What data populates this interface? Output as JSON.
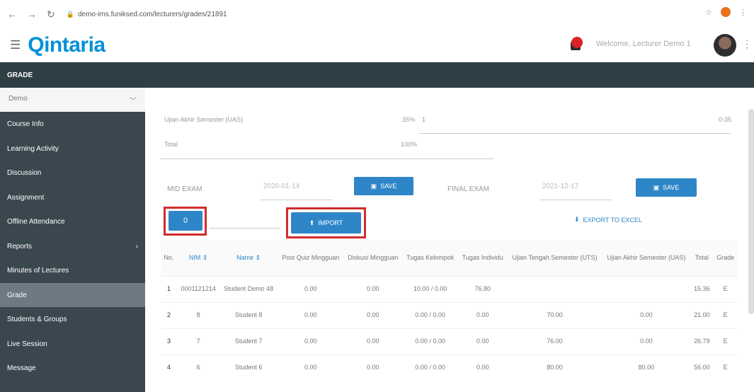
{
  "browser": {
    "url": "demo-ims.funiksed.com/lecturers/grades/21891"
  },
  "app": {
    "logo": "Qintaria",
    "welcome": "Welcome, Lecturer Demo 1"
  },
  "page": {
    "title": "GRADE"
  },
  "sidebar": {
    "course_select": "Demo",
    "items": [
      {
        "label": "Course Info",
        "active": false
      },
      {
        "label": "Learning Activity",
        "active": false
      },
      {
        "label": "Discussion",
        "active": false
      },
      {
        "label": "Assignment",
        "active": false
      },
      {
        "label": "Offline Attendance",
        "active": false
      },
      {
        "label": "Reports",
        "active": false,
        "chevron": "›"
      },
      {
        "label": "Minutes of Lectures",
        "active": false
      },
      {
        "label": "Grade",
        "active": true
      },
      {
        "label": "Students & Groups",
        "active": false
      },
      {
        "label": "Live Session",
        "active": false
      },
      {
        "label": "Message",
        "active": false
      }
    ]
  },
  "weights": {
    "uas_label": "Ujian Akhir Semester (UAS)",
    "uas_percent": "35%",
    "uas_value": "1",
    "uas_range": "0-35",
    "total_label": "Total",
    "total_percent": "100%"
  },
  "exams": {
    "mid_label": "MID EXAM",
    "mid_date": "2020-01-14",
    "final_label": "FINAL EXAM",
    "final_date": "2021-12-17",
    "save_label": "SAVE"
  },
  "toolbar": {
    "zero_button": "0",
    "import_label": "IMPORT",
    "export_label": "EXPORT TO EXCEL"
  },
  "table": {
    "headers": [
      "No.",
      "NIM ⇕",
      "Name ⇕",
      "Post Quiz Mingguan",
      "Diskusi Mingguan",
      "Tugas Kelompok",
      "Tugas Individu",
      "Ujian Tengah Semester (UTS)",
      "Ujian Akhir Semester (UAS)",
      "Total",
      "Grade"
    ],
    "rows": [
      [
        "1",
        "0001121214",
        "Student Demo 48",
        "0.00",
        "0.00",
        "10.00 / 0.00",
        "76.80",
        "",
        "",
        "15.36",
        "E"
      ],
      [
        "2",
        "8",
        "Student 8",
        "0.00",
        "0.00",
        "0.00 / 0.00",
        "0.00",
        "70.00",
        "0.00",
        "21.00",
        "E"
      ],
      [
        "3",
        "7",
        "Student 7",
        "0.00",
        "0.00",
        "0.00 / 0.00",
        "0.00",
        "76.00",
        "0.00",
        "26.79",
        "E"
      ],
      [
        "4",
        "6",
        "Student 6",
        "0.00",
        "0.00",
        "0.00 / 0.00",
        "0.00",
        "80.00",
        "80.00",
        "56.00",
        "E"
      ]
    ]
  }
}
